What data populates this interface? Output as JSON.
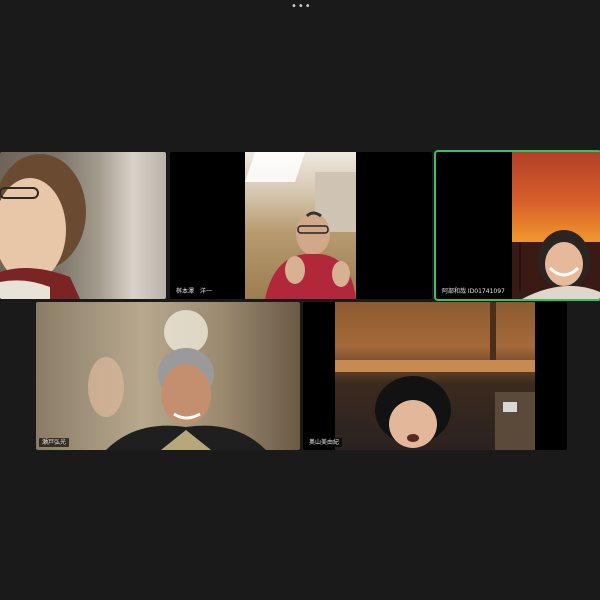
{
  "toolbar": {
    "more_label": "•••"
  },
  "participants": [
    {
      "name": ""
    },
    {
      "name": "桝本澤　洋一"
    },
    {
      "name": "阿部和哉 ID01741097"
    },
    {
      "name": "瀬戸弘光"
    },
    {
      "name": "奥山美由紀"
    }
  ],
  "colors": {
    "background": "#1a1a1a",
    "active_speaker_border": "#3cbf5c",
    "tile_background": "#000000"
  }
}
